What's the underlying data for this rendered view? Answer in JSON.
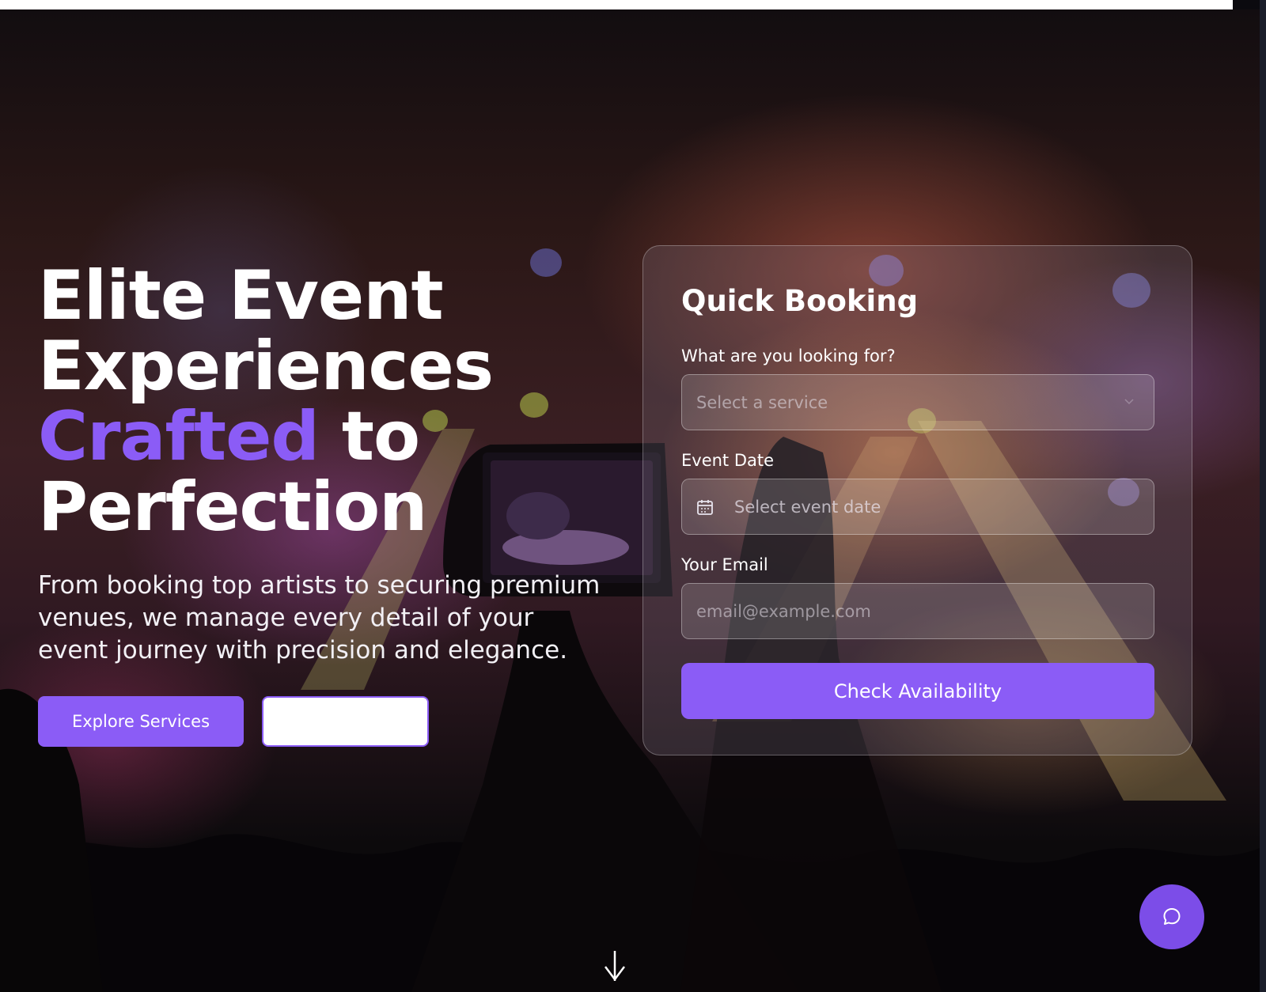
{
  "colors": {
    "accent": "#8b5cf6",
    "chat": "#7c4de8"
  },
  "hero": {
    "headline": {
      "line1": "Elite Event",
      "line2": "Experiences",
      "accent_word": "Crafted",
      "after_accent": " to",
      "line4": "Perfection"
    },
    "subtext": "From booking top artists to securing premium venues, we manage every detail of your event journey with precision and elegance.",
    "primary_button": "Explore Services",
    "secondary_button": ""
  },
  "booking": {
    "title": "Quick Booking",
    "service": {
      "label": "What are you looking for?",
      "placeholder": "Select a service",
      "icon": "chevron-down-icon"
    },
    "date": {
      "label": "Event Date",
      "placeholder": "Select event date",
      "icon": "calendar-icon"
    },
    "email": {
      "label": "Your Email",
      "placeholder": "email@example.com"
    },
    "submit": "Check Availability"
  },
  "widgets": {
    "chat_icon": "chat-bubble-icon",
    "scroll_icon": "arrow-down-icon"
  }
}
